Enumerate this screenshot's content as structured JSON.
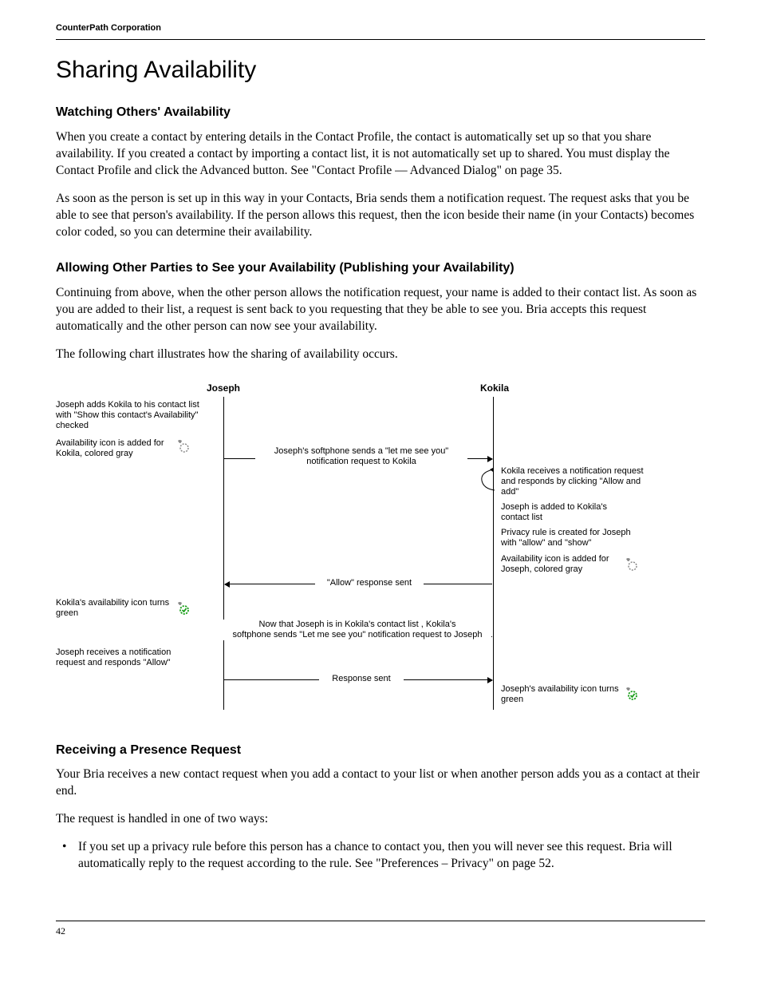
{
  "header": {
    "company": "CounterPath Corporation"
  },
  "title": "Sharing Availability",
  "s1": {
    "heading": "Watching Others' Availability",
    "p1": "When you create a contact by entering details in the Contact Profile, the contact is automatically set up so that you share availability. If you created a contact by importing a contact list, it is not automatically set up to shared. You must display the Contact Profile and click the Advanced button. See \"Contact Profile — Advanced Dialog\" on page 35.",
    "p2": "As soon as the person is set up in this way in your Contacts, Bria sends them a notification request. The request asks that you be able to see that person's availability. If the person allows this request, then the icon beside their name (in your Contacts) becomes color coded, so you can determine their availability."
  },
  "s2": {
    "heading": "Allowing Other Parties to See your Availability (Publishing your Availability)",
    "p1": "Continuing from above, when the other person allows the notification request, your name is added to their contact list. As soon as you are added to their list, a request is sent back to you requesting that they be able to see you. Bria accepts this request automatically and the other person can now see your availability.",
    "p2": "The following chart illustrates how the sharing of availability occurs."
  },
  "diagram": {
    "joseph": "Joseph",
    "kokila": "Kokila",
    "j1": "Joseph adds Kokila to his contact list with \"Show this contact's Availability\" checked",
    "j2": "Availability icon is added for Kokila, colored gray",
    "msg1a": "Joseph's softphone sends a \"let me see you\"",
    "msg1b": "notification request to Kokila",
    "k1": "Kokila receives a notification request and responds by clicking \"Allow and add\"",
    "k2": "Joseph is added to Kokila's contact list",
    "k3": "Privacy rule is created for Joseph with \"allow\" and \"show\"",
    "k4": "Availability icon is added for Joseph, colored gray",
    "msg2": "\"Allow\" response sent",
    "j3": "Kokila's availability icon turns green",
    "msg3a": "Now that Joseph is in Kokila's contact list , Kokila's",
    "msg3b": "softphone sends \"Let me see you\" notification request to Joseph",
    "j4": "Joseph receives a notification request and responds \"Allow\"",
    "msg4": "Response sent",
    "k5": "Joseph's availability icon turns green"
  },
  "s3": {
    "heading": "Receiving a Presence Request",
    "p1": "Your Bria receives a new contact request when you add a contact to your list or when another person adds you as a contact at their end.",
    "p2": "The request is handled in one of two ways:",
    "bullet1": "If you set up a privacy rule before this person has a chance to contact you, then you will never see this request. Bria will automatically reply to the request according to the rule. See \"Preferences – Privacy\" on page 52."
  },
  "footer": {
    "page": "42"
  }
}
